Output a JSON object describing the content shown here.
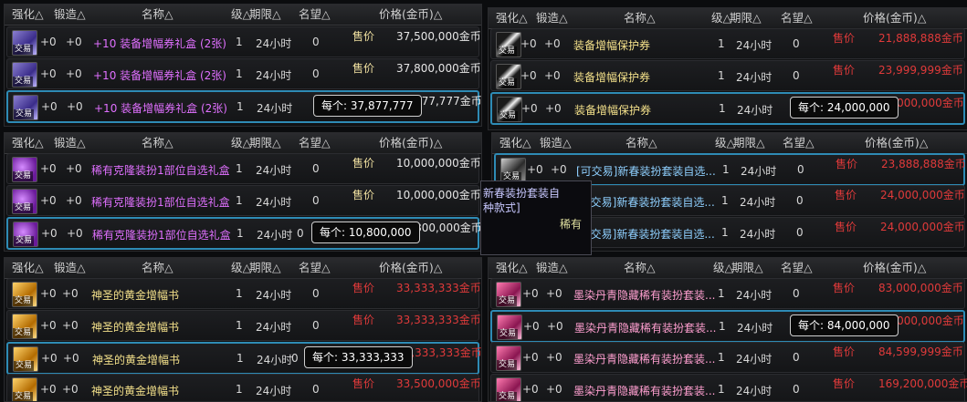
{
  "headers": {
    "qh": "强化△",
    "dz": "锻造△",
    "name": "名称△",
    "level": "级△",
    "limit": "期限△",
    "fame": "名望△",
    "price": "价格(金币)△"
  },
  "common": {
    "sell": "售价",
    "trade_tag": "交易",
    "plus0": "+0",
    "qty": "1",
    "period": "24小时",
    "fame_val": "0"
  },
  "left_panels": [
    {
      "rows": [
        {
          "name": "+10 装备增幅券礼盒 (2张)",
          "price": "37,500,000金币"
        },
        {
          "name": "+10 装备增幅券礼盒 (2张)",
          "price": "37,800,000金币"
        },
        {
          "name": "+10 装备增幅券礼盒 (2张)",
          "price": "37,877,777金币",
          "tooltip": "每个: 37,877,777"
        }
      ]
    },
    {
      "rows": [
        {
          "name": "稀有克隆装扮1部位自选礼盒",
          "price": "10,000,000金币"
        },
        {
          "name": "稀有克隆装扮1部位自选礼盒",
          "price": "10,000,000金币"
        },
        {
          "name": "稀有克隆装扮1部位自选礼盒",
          "price": "10,800,000金币",
          "tooltip": "每个: 10,800,000"
        }
      ]
    },
    {
      "rows": [
        {
          "name": "神圣的黄金增幅书",
          "price": "33,333,333金币"
        },
        {
          "name": "神圣的黄金增幅书",
          "price": "33,333,333金币"
        },
        {
          "name": "神圣的黄金增幅书",
          "price": "33,333,333金币",
          "tooltip": "每个: 33,333,333"
        },
        {
          "name": "神圣的黄金增幅书",
          "price": "33,500,000金币"
        }
      ]
    }
  ],
  "right_panels": [
    {
      "rows": [
        {
          "name": "装备增幅保护券",
          "price": "21,888,888金币"
        },
        {
          "name": "装备增幅保护券",
          "price": "23,999,999金币"
        },
        {
          "name": "装备增幅保护券",
          "price": "24,000,000金币",
          "tooltip": "每个: 24,000,000"
        }
      ]
    },
    {
      "rows": [
        {
          "name": "[可交易]新春装扮套装自选...",
          "price": "23,888,888金币"
        },
        {
          "name": "[可交易]新春装扮套装自选...",
          "price": "24,000,000金币"
        },
        {
          "name": "[可交易]新春装扮套装自选...",
          "price": "24,000,000金币"
        }
      ]
    },
    {
      "rows": [
        {
          "name": "墨染丹青隐藏稀有装扮套装...",
          "price": "83,000,000金币"
        },
        {
          "name": "墨染丹青隐藏稀有装扮套装...",
          "price": "84,000,000金币",
          "tooltip": "每个: 84,000,000"
        },
        {
          "name": "墨染丹青隐藏稀有装扮套装...",
          "price": "84,599,999金币"
        },
        {
          "name": "墨染丹青隐藏稀有装扮套装...",
          "price": "169,200,000金币"
        }
      ]
    }
  ],
  "popup": {
    "line1": "新春装扮套装自",
    "line2": "种款式]",
    "line3": "稀有"
  },
  "overlap_text": {
    "t1": "交易",
    "t2": "稀有"
  }
}
